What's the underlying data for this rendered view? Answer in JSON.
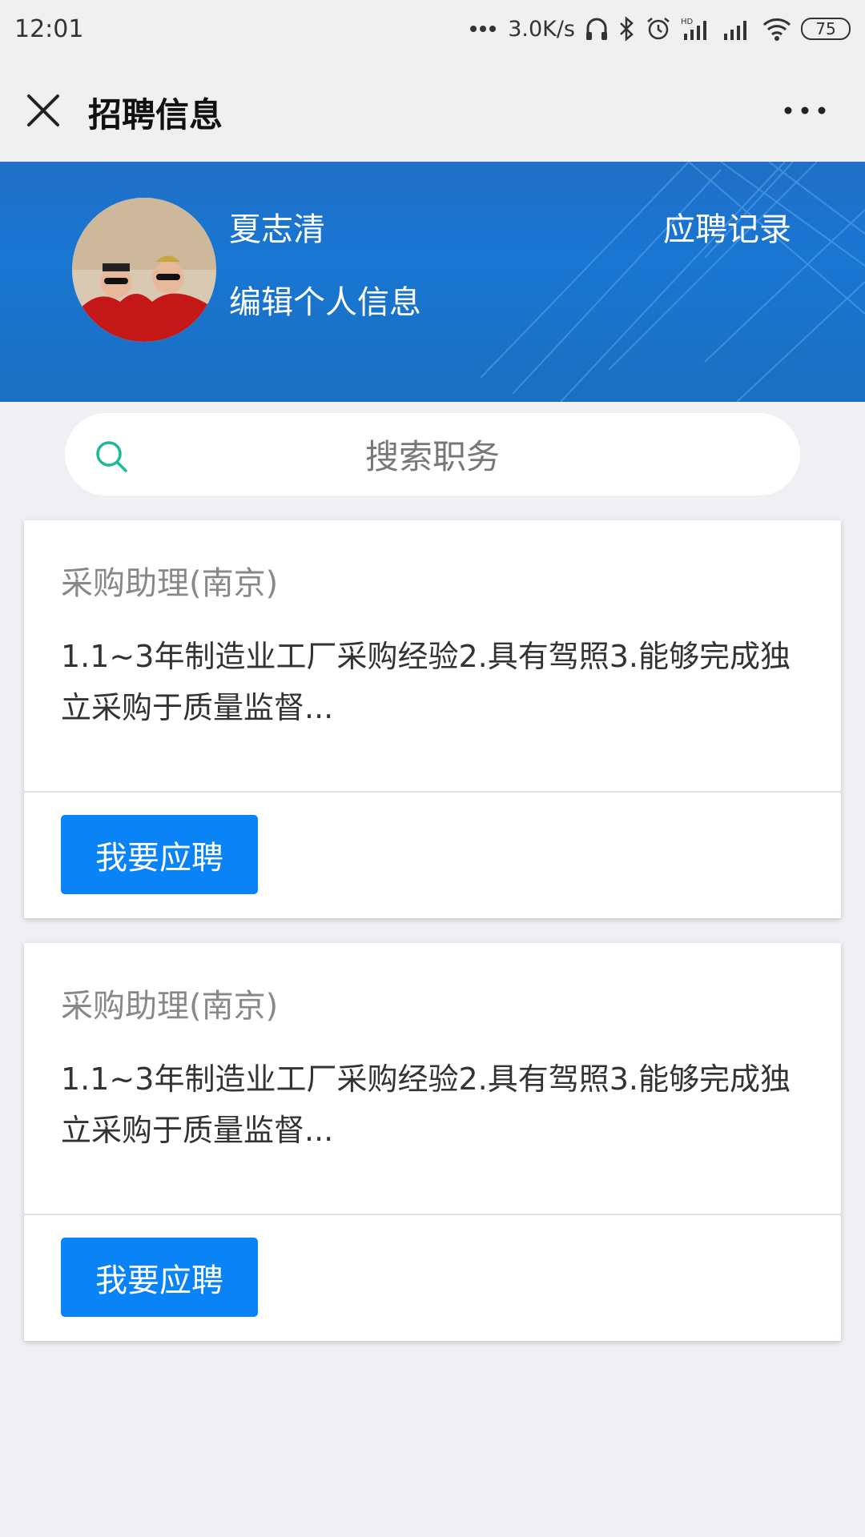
{
  "status_bar": {
    "time": "12:01",
    "network_speed": "3.0K/s",
    "battery": "75",
    "icons": [
      "dots-icon",
      "headphones-icon",
      "bluetooth-icon",
      "alarm-icon",
      "hd-signal-icon",
      "signal-icon",
      "wifi-icon",
      "battery-icon"
    ]
  },
  "nav": {
    "title": "招聘信息",
    "close_icon": "close-icon",
    "more_icon": "more-icon"
  },
  "profile": {
    "name": "夏志清",
    "edit_label": "编辑个人信息",
    "records_label": "应聘记录",
    "banner_color": "#1976d2"
  },
  "search": {
    "placeholder": "搜索职务",
    "icon": "search-icon",
    "icon_color": "#1fb89a"
  },
  "jobs": [
    {
      "title": "采购助理(南京)",
      "description": "1.1~3年制造业工厂采购经验2.具有驾照3.能够完成独立采购于质量监督...",
      "apply_label": "我要应聘"
    },
    {
      "title": "采购助理(南京)",
      "description": "1.1~3年制造业工厂采购经验2.具有驾照3.能够完成独立采购于质量监督...",
      "apply_label": "我要应聘"
    }
  ],
  "colors": {
    "accent": "#0a83f7",
    "background": "#efeff4"
  }
}
